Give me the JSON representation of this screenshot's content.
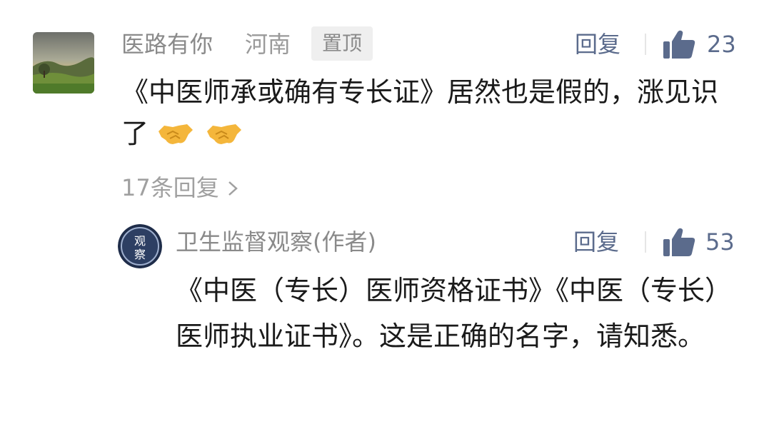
{
  "comment": {
    "author": "医路有你",
    "region": "河南",
    "pin_label": "置顶",
    "reply_label": "回复",
    "likes": "23",
    "text": "《中医师承或确有专长证》居然也是假的，涨见识了",
    "emoji": "handshake-emoji",
    "more_replies": "17条回复",
    "more_replies_chevron": "chevron-right-icon"
  },
  "author_reply": {
    "author": "卫生监督观察(作者)",
    "reply_label": "回复",
    "likes": "53",
    "text": "《中医（专长）医师资格证书》《中医（专长）医师执业证书》。这是正确的名字，请知悉。",
    "avatar_text": "观察"
  },
  "colors": {
    "name": "#8a8a8a",
    "action": "#5b6b8c",
    "body_text": "#1a1a1a",
    "muted": "#a0a0a0"
  }
}
